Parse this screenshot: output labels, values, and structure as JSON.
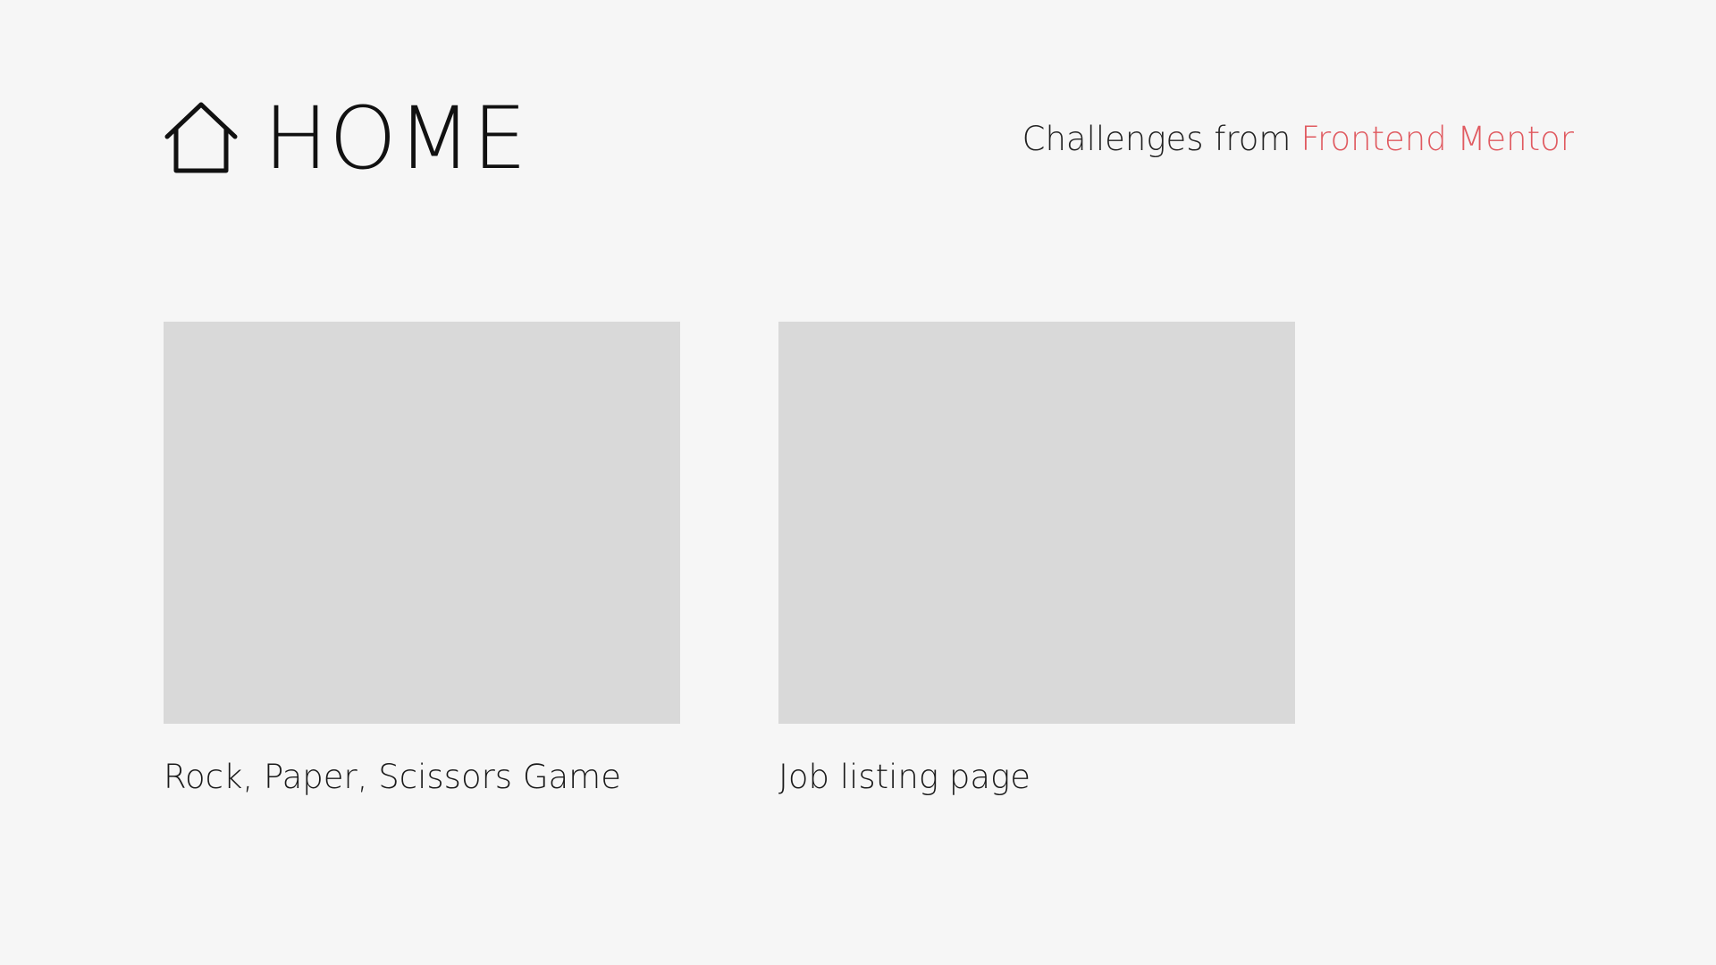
{
  "header": {
    "title": "HOME",
    "icon": "home-icon",
    "credit_text": "Challenges from",
    "credit_link": "Frontend Mentor"
  },
  "colors": {
    "background": "#f6f6f6",
    "thumbnail": "#d9d9d9",
    "accent": "#e05a60",
    "text": "#111111"
  },
  "projects": [
    {
      "label": "Rock, Paper, Scissors Game"
    },
    {
      "label": "Job listing page"
    }
  ]
}
